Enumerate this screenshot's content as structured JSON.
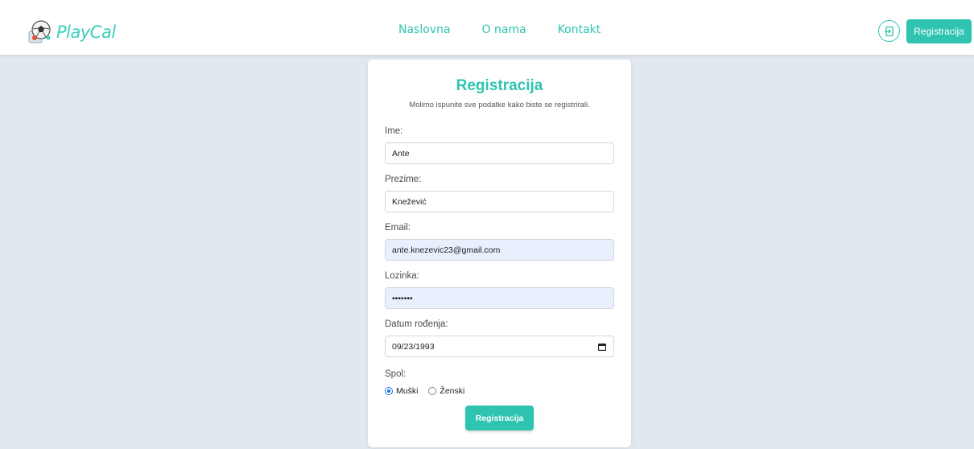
{
  "brand": {
    "name": "PlayCal"
  },
  "nav": {
    "items": [
      "Naslovna",
      "O nama",
      "Kontakt"
    ]
  },
  "header": {
    "register_label": "Registracija"
  },
  "form": {
    "title": "Registracija",
    "subtitle": "Molimo ispunite sve podatke kako biste se registrirali.",
    "first_name": {
      "label": "Ime:",
      "value": "Ante"
    },
    "last_name": {
      "label": "Prezime:",
      "value": "Knežević"
    },
    "email": {
      "label": "Email:",
      "value": "ante.knezevic23@gmail.com"
    },
    "password": {
      "label": "Lozinka:",
      "value": "•••••••"
    },
    "birth_date": {
      "label": "Datum rođenja:",
      "value": "09/23/1993"
    },
    "gender": {
      "label": "Spol:",
      "options": [
        "Muški",
        "Ženski"
      ],
      "selected": "Muški"
    },
    "submit_label": "Registracija"
  },
  "colors": {
    "accent": "#2ec4b0",
    "page_bg": "#e2e8f0",
    "autofill_bg": "#e8f0fe"
  }
}
